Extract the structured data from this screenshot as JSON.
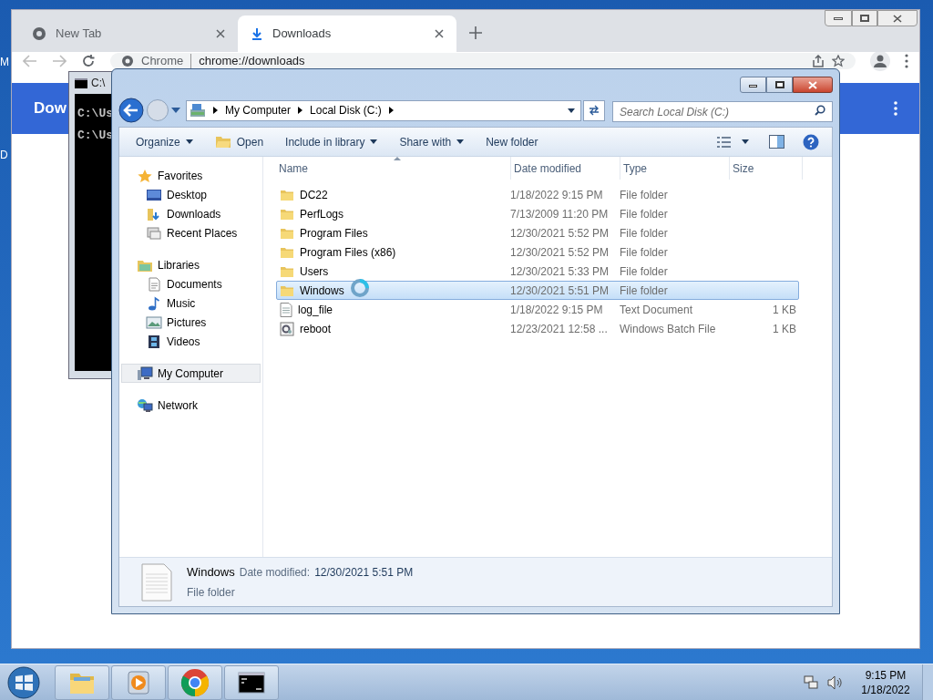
{
  "desktop": {
    "icon_labels": [
      "M",
      "D"
    ]
  },
  "browser": {
    "tabs": [
      {
        "title": "New Tab",
        "selected": false
      },
      {
        "title": "Downloads",
        "selected": true
      }
    ],
    "address": {
      "site_label": "Chrome",
      "url": "chrome://downloads"
    },
    "page_header": "Dow"
  },
  "console": {
    "title": "C:\\",
    "lines": [
      "C:\\Us",
      "C:\\Us"
    ]
  },
  "explorer": {
    "breadcrumb": [
      "My Computer",
      "Local Disk (C:)"
    ],
    "search": {
      "placeholder": "Search Local Disk (C:)"
    },
    "toolbar": [
      {
        "label": "Organize",
        "kind": "menu"
      },
      {
        "label": "Open",
        "kind": "open"
      },
      {
        "label": "Include in library",
        "kind": "menu"
      },
      {
        "label": "Share with",
        "kind": "menu"
      },
      {
        "label": "New folder",
        "kind": "button"
      }
    ],
    "nav": [
      {
        "label": "Favorites",
        "kind": "star",
        "selected": false,
        "children": [
          {
            "label": "Desktop",
            "kind": "desktop",
            "selected": false
          },
          {
            "label": "Downloads",
            "kind": "downloads",
            "selected": false
          },
          {
            "label": "Recent Places",
            "kind": "recent",
            "selected": false
          }
        ]
      },
      {
        "label": "Libraries",
        "kind": "library",
        "selected": false,
        "children": [
          {
            "label": "Documents",
            "kind": "document",
            "selected": false
          },
          {
            "label": "Music",
            "kind": "music",
            "selected": false
          },
          {
            "label": "Pictures",
            "kind": "picture",
            "selected": false
          },
          {
            "label": "Videos",
            "kind": "video",
            "selected": false
          }
        ]
      },
      {
        "label": "My Computer",
        "kind": "computer",
        "selected": true
      },
      {
        "label": "Network",
        "kind": "network",
        "selected": false
      }
    ],
    "columns": [
      "Name",
      "Date modified",
      "Type",
      "Size"
    ],
    "files": [
      {
        "name": "DC22",
        "date": "1/18/2022 9:15 PM",
        "type": "File folder",
        "kind": "folder",
        "selected": false
      },
      {
        "name": "PerfLogs",
        "date": "7/13/2009 11:20 PM",
        "type": "File folder",
        "kind": "folder",
        "selected": false
      },
      {
        "name": "Program Files",
        "date": "12/30/2021 5:52 PM",
        "type": "File folder",
        "kind": "folder",
        "selected": false
      },
      {
        "name": "Program Files (x86)",
        "date": "12/30/2021 5:52 PM",
        "type": "File folder",
        "kind": "folder",
        "selected": false
      },
      {
        "name": "Users",
        "date": "12/30/2021 5:33 PM",
        "type": "File folder",
        "kind": "folder",
        "selected": false
      },
      {
        "name": "Windows",
        "date": "12/30/2021 5:51 PM",
        "type": "File folder",
        "kind": "folder",
        "selected": true
      },
      {
        "name": "log_file",
        "date": "1/18/2022 9:15 PM",
        "type": "Text Document",
        "size": "1 KB",
        "kind": "text",
        "selected": false
      },
      {
        "name": "reboot",
        "date": "12/23/2021 12:58 ...",
        "type": "Windows Batch File",
        "size": "1 KB",
        "kind": "batch",
        "selected": false
      }
    ],
    "details": {
      "name": "Windows",
      "date_label": "Date modified:",
      "date": "12/30/2021 5:51 PM",
      "type": "File folder"
    }
  },
  "taskbar": {
    "apps": [
      {
        "kind": "explorer"
      },
      {
        "kind": "media"
      },
      {
        "kind": "chrome"
      },
      {
        "kind": "console"
      }
    ],
    "clock": {
      "time": "9:15 PM",
      "date": "1/18/2022"
    }
  }
}
